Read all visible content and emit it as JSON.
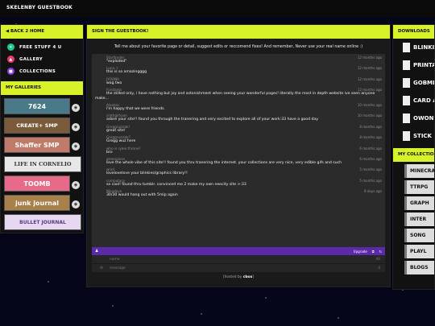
{
  "site": {
    "title": "SKELENBY GUESTBOOK"
  },
  "left": {
    "back_label": "BACK 2 HOME",
    "nav": [
      {
        "label": "FREE STUFF 4 U",
        "color": "#1ec98a",
        "icon": "gift-icon"
      },
      {
        "label": "GALLERY",
        "color": "#e83a6a",
        "icon": "image-icon"
      },
      {
        "label": "COLLECTIONS",
        "color": "#8a3ae8",
        "icon": "folder-icon"
      }
    ],
    "galleries_header": "MY GALLERIES",
    "galleries": [
      {
        "label": "7624",
        "bg": "#4a7a8a",
        "fg": "#fff"
      },
      {
        "label": "CREATE+ SMP",
        "bg": "#7b5a3a",
        "fg": "#fff"
      },
      {
        "label": "Shaffer SMP",
        "bg": "#c07a6a",
        "fg": "#fff"
      },
      {
        "label": "LIFE IN CORNELIO",
        "bg": "#e8e8e8",
        "fg": "#333"
      },
      {
        "label": "TOOMB",
        "bg": "#e86a8a",
        "fg": "#fff"
      },
      {
        "label": "junk journal",
        "bg": "#a8804a",
        "fg": "#fff"
      },
      {
        "label": "BULLET JOURNAL",
        "bg": "#e6d8f0",
        "fg": "#5a3a8a"
      }
    ]
  },
  "center": {
    "header": "SIGN THE GUESTBOOK!",
    "intro": "Tell me about your favorite page or detail, suggest edits or reccomend fixes! And remember, Never use your real name online :)",
    "entries": [
      {
        "name": "Starfander",
        "time": "12 months ago",
        "msg": "\"exploded\""
      },
      {
        "name": "Luna :)",
        "time": "12 months ago",
        "msg": "this is so amazingggg"
      },
      {
        "name": "JYOONII",
        "time": "12 months ago",
        "msg": "wag two"
      },
      {
        "name": "Fondants",
        "time": "12 months ago",
        "msg": "the stilled only, i have nothing but joy and astonishment when seeing your wonderful pages! literally the most in depth website ive seen anyone make..."
      },
      {
        "name": "Alaskas",
        "time": "10 months ago",
        "msg": "i'm happy that we were friends."
      },
      {
        "name": "clothgirlsam",
        "time": "10 months ago",
        "msg": "adore your site!! found you through the tranering and very excited to explore all of your work:33 have a good day"
      },
      {
        "name": "Greggruzziak!",
        "time": "8 months ago",
        "msg": "great site!"
      },
      {
        "name": "Greggruzziak?",
        "time": "8 months ago",
        "msg": "Gregg wuz here"
      },
      {
        "name": "who is rylee throne?",
        "time": "6 months ago",
        "msg": "bro"
      },
      {
        "name": "greenpions",
        "time": "6 months ago",
        "msg": "love the whole vibe of this site!! found you thru tranering the internet. your collections are very nice, very edible gifs and such"
      },
      {
        "name": "wind",
        "time": "5 months ago",
        "msg": "lovelovelove your blinkies/graphics library!!"
      },
      {
        "name": "computacy",
        "time": "5 months ago",
        "msg": "so cool! found thru tumblr. convinced me 2 make my own neocity site >:33"
      },
      {
        "name": "Nikodays",
        "time": "8 days ago",
        "msg": "30/30 would hang out with 5mip again"
      }
    ],
    "cbox_upgrade": "Upgrade",
    "name_placeholder": "name",
    "name_count": "40",
    "message_placeholder": "message",
    "message_count": "4",
    "hosted_prefix": "[hosted by ",
    "hosted_brand": "cbox",
    "hosted_suffix": "]"
  },
  "right": {
    "downloads_header": "DOWNLOADS",
    "downloads": [
      "BLINKI",
      "PRINTA",
      "GOBMI",
      "CARD ACTIVIT",
      "OWON",
      "STICK"
    ],
    "collections_header": "MY COLLECTIONS",
    "collections": [
      "MINECRAFT",
      "TTRPG",
      "GRAPH",
      "INTER",
      "SONG",
      "PLAYL",
      "BLOGS"
    ]
  }
}
